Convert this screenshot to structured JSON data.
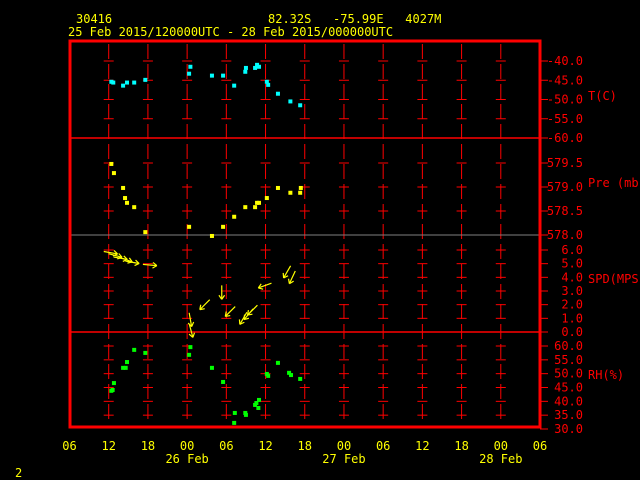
{
  "header": {
    "station": "30416",
    "location": "82.32S   -75.99E   4027M",
    "time_range": "25 Feb 2015/120000UTC - 28 Feb 2015/000000UTC"
  },
  "footer": {
    "page": "2"
  },
  "colors": {
    "frame": "#ff0000",
    "text": "#ffff00",
    "temp": "#00ffff",
    "pressure": "#ffff00",
    "wind": "#ffff00",
    "rh": "#00ff00",
    "divider": "#808080"
  },
  "chart_data": {
    "type": "scatter",
    "title": "30416 82.32S -75.99E 4027M",
    "x_units": "hours since 25 Feb 2015 06UTC",
    "xlim": [
      0,
      72
    ],
    "x_ticks": [
      "06",
      "12",
      "18",
      "00",
      "06",
      "12",
      "18",
      "00",
      "06",
      "12",
      "18",
      "00",
      "06"
    ],
    "date_labels": [
      {
        "hour": 18,
        "label": "26 Feb"
      },
      {
        "hour": 42,
        "label": "27 Feb"
      },
      {
        "hour": 66,
        "label": "28 Feb"
      }
    ],
    "panels": [
      {
        "name": "temperature",
        "label": "T(C)",
        "ylim": [
          -60,
          -40
        ],
        "ticks": [
          "-40.0",
          "-45.0",
          "-50.0",
          "-55.0",
          "-60.0"
        ],
        "tick_values": [
          -40,
          -45,
          -50,
          -55,
          -60
        ],
        "points": [
          [
            6.4,
            -45.4
          ],
          [
            6.7,
            -45.6
          ],
          [
            8.2,
            -46.4
          ],
          [
            8.8,
            -45.6
          ],
          [
            9.9,
            -45.6
          ],
          [
            11.6,
            -44.9
          ],
          [
            18.3,
            -43.3
          ],
          [
            18.5,
            -41.5
          ],
          [
            21.8,
            -43.8
          ],
          [
            23.5,
            -43.8
          ],
          [
            25.2,
            -46.4
          ],
          [
            26.9,
            -42.8
          ],
          [
            27.0,
            -41.8
          ],
          [
            28.4,
            -41.8
          ],
          [
            28.7,
            -41.0
          ],
          [
            29.0,
            -41.5
          ],
          [
            30.2,
            -45.4
          ],
          [
            30.4,
            -46.2
          ],
          [
            31.9,
            -48.5
          ],
          [
            33.8,
            -50.5
          ],
          [
            35.3,
            -51.5
          ]
        ]
      },
      {
        "name": "pressure",
        "label": "Pre (mb)",
        "ylim": [
          578.0,
          580.0
        ],
        "ticks": [
          "579.5",
          "579.0",
          "578.5",
          "578.0"
        ],
        "tick_values": [
          579.5,
          579.0,
          578.5,
          578.0
        ],
        "points": [
          [
            6.4,
            579.48
          ],
          [
            6.8,
            579.29
          ],
          [
            8.2,
            578.98
          ],
          [
            8.5,
            578.77
          ],
          [
            8.8,
            578.67
          ],
          [
            9.9,
            578.58
          ],
          [
            11.6,
            578.06
          ],
          [
            18.3,
            578.17
          ],
          [
            21.8,
            577.98
          ],
          [
            23.5,
            578.17
          ],
          [
            25.2,
            578.38
          ],
          [
            26.9,
            578.58
          ],
          [
            28.4,
            578.58
          ],
          [
            28.7,
            578.67
          ],
          [
            29.0,
            578.67
          ],
          [
            30.2,
            578.77
          ],
          [
            31.9,
            578.98
          ],
          [
            33.8,
            578.88
          ],
          [
            35.3,
            578.88
          ],
          [
            35.4,
            578.98
          ]
        ]
      },
      {
        "name": "wind_speed",
        "label": "SPD(MPS)",
        "ylim": [
          0,
          7.1
        ],
        "ticks": [
          "6.0",
          "5.0",
          "4.0",
          "3.0",
          "2.0",
          "1.0",
          "0.0"
        ],
        "tick_values": [
          6,
          5,
          4,
          3,
          2,
          1,
          0
        ],
        "points": [
          [
            6.3,
            5.8,
            100
          ],
          [
            7.0,
            5.6,
            105
          ],
          [
            7.8,
            5.4,
            100
          ],
          [
            8.6,
            5.3,
            110
          ],
          [
            9.6,
            5.1,
            100
          ],
          [
            12.3,
            4.9,
            95
          ],
          [
            18.5,
            0.9,
            170
          ],
          [
            18.6,
            0.1,
            165
          ],
          [
            20.7,
            2.0,
            225
          ],
          [
            23.3,
            2.9,
            180
          ],
          [
            24.6,
            1.5,
            225
          ],
          [
            26.6,
            1.0,
            210
          ],
          [
            27.4,
            1.3,
            220
          ],
          [
            28.0,
            1.6,
            225
          ],
          [
            29.9,
            3.4,
            250
          ],
          [
            33.3,
            4.4,
            210
          ],
          [
            34.1,
            4.0,
            205
          ]
        ]
      },
      {
        "name": "relative_humidity",
        "label": "RH(%)",
        "ylim": [
          30,
          65
        ],
        "ticks": [
          "60.0",
          "55.0",
          "50.0",
          "45.0",
          "40.0",
          "35.0",
          "30.0"
        ],
        "tick_values": [
          60,
          55,
          50,
          45,
          40,
          35,
          30
        ],
        "points": [
          [
            6.4,
            43.8
          ],
          [
            6.6,
            44.1
          ],
          [
            6.8,
            46.6
          ],
          [
            8.2,
            52.1
          ],
          [
            8.6,
            52.1
          ],
          [
            8.8,
            54.2
          ],
          [
            9.9,
            58.6
          ],
          [
            11.6,
            57.5
          ],
          [
            18.3,
            56.8
          ],
          [
            18.5,
            59.6
          ],
          [
            21.8,
            52.1
          ],
          [
            23.5,
            47.0
          ],
          [
            25.2,
            32.2
          ],
          [
            25.3,
            35.8
          ],
          [
            26.9,
            35.8
          ],
          [
            27.0,
            35.1
          ],
          [
            28.4,
            38.7
          ],
          [
            28.6,
            39.4
          ],
          [
            28.9,
            37.6
          ],
          [
            29.0,
            40.5
          ],
          [
            30.2,
            49.9
          ],
          [
            30.4,
            49.2
          ],
          [
            31.9,
            53.9
          ],
          [
            33.6,
            50.3
          ],
          [
            33.9,
            49.5
          ],
          [
            35.3,
            48.1
          ]
        ]
      }
    ]
  }
}
